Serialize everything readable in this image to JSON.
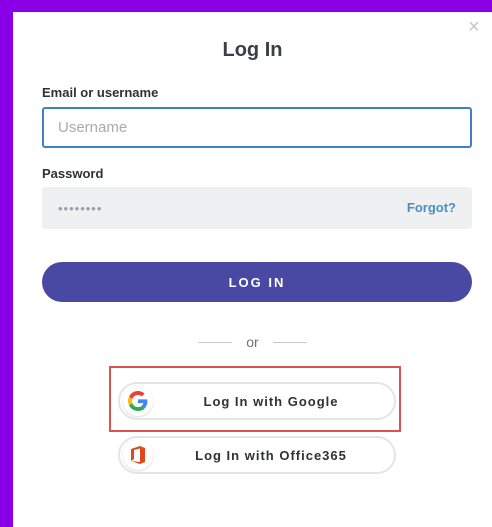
{
  "modal": {
    "title": "Log In",
    "close_symbol": "×",
    "email_label": "Email or username",
    "username_placeholder": "Username",
    "password_label": "Password",
    "password_masked": "••••••••",
    "forgot_label": "Forgot?",
    "login_label": "LOG IN",
    "or_label": "or",
    "google_label": "Log In with Google",
    "office_label": "Log In with Office365"
  },
  "colors": {
    "accent": "#4949a3",
    "link": "#4a8ec7",
    "focus_border": "#3f82c6",
    "highlight": "#d9534f",
    "background": "#8a00e6"
  },
  "icons": {
    "close": "close-icon",
    "google": "google-g-icon",
    "office": "office365-icon"
  }
}
